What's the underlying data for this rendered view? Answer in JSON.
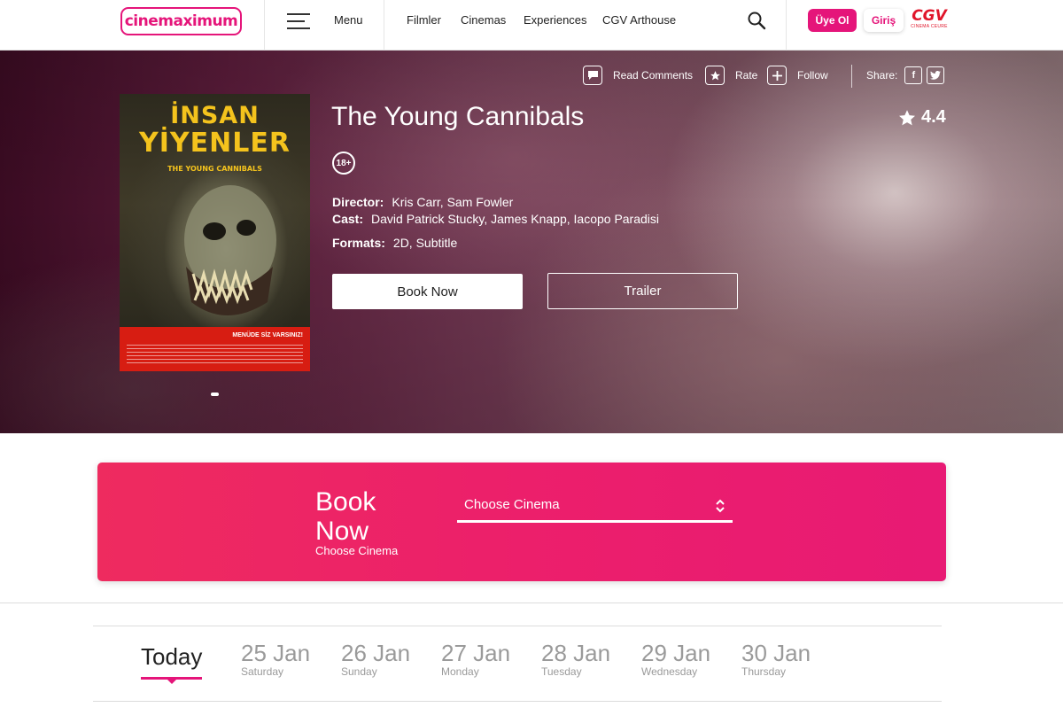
{
  "header": {
    "logo_text": "cinemaximum",
    "menu_label": "Menu",
    "nav": [
      "Filmler",
      "Cinemas",
      "Experiences",
      "CGV Arthouse"
    ],
    "register_label": "Üye Ol",
    "login_label": "Giriş",
    "cgv_text": "CGV",
    "cgv_sub": "CINEMA CEURE",
    "accent_color": "#e5157a"
  },
  "hero": {
    "actions": {
      "read_comments": "Read Comments",
      "rate": "Rate",
      "follow": "Follow",
      "share": "Share:",
      "facebook": "f",
      "twitter": "t"
    },
    "poster": {
      "title_line1": "İNSAN",
      "title_line2": "YİYENLER",
      "subtitle": "THE YOUNG CANNIBALS",
      "tagline": "MENÜDE SİZ VARSINIZ!"
    },
    "title": "The Young Cannibals",
    "rating": "4.4",
    "age_rating": "18+",
    "director_label": "Director:",
    "director": "Kris Carr, Sam Fowler",
    "cast_label": "Cast:",
    "cast": "David Patrick Stucky, James Knapp, Iacopo Paradisi",
    "formats_label": "Formats:",
    "formats": "2D, Subtitle",
    "book_now": "Book Now",
    "trailer": "Trailer"
  },
  "booking": {
    "title": "Book Now",
    "subtitle": "Choose Cinema",
    "select_placeholder": "Choose Cinema"
  },
  "dates": {
    "today": "Today",
    "items": [
      {
        "date": "25 Jan",
        "day": "Saturday"
      },
      {
        "date": "26 Jan",
        "day": "Sunday"
      },
      {
        "date": "27 Jan",
        "day": "Monday"
      },
      {
        "date": "28 Jan",
        "day": "Tuesday"
      },
      {
        "date": "29 Jan",
        "day": "Wednesday"
      },
      {
        "date": "30 Jan",
        "day": "Thursday"
      }
    ]
  }
}
